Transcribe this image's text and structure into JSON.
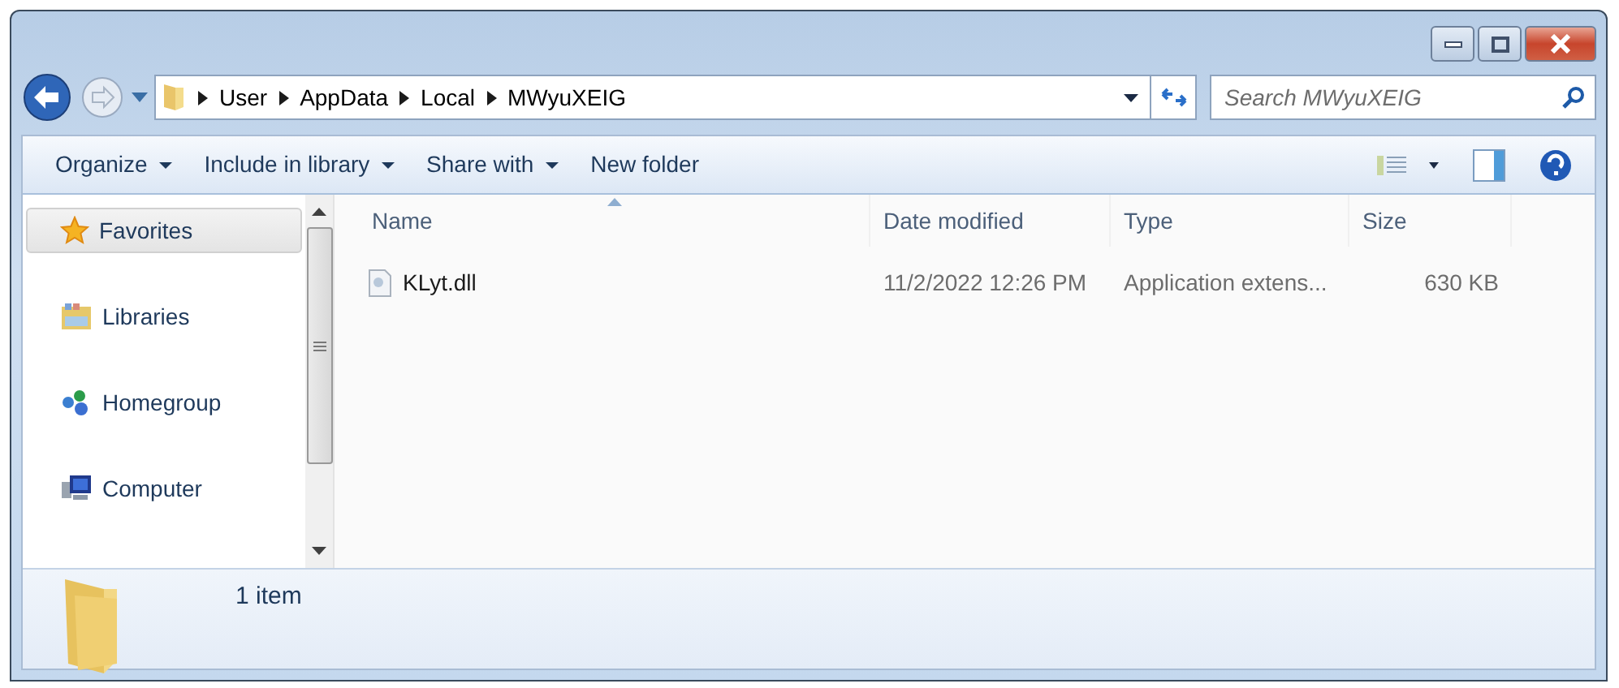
{
  "address": {
    "path": [
      "User",
      "AppData",
      "Local",
      "MWyuXEIG"
    ]
  },
  "search": {
    "placeholder": "Search MWyuXEIG"
  },
  "toolbar": [
    {
      "label": "Organize",
      "has_menu": true
    },
    {
      "label": "Include in library",
      "has_menu": true
    },
    {
      "label": "Share with",
      "has_menu": true
    },
    {
      "label": "New folder",
      "has_menu": false
    }
  ],
  "nav": [
    {
      "label": "Favorites",
      "kind": "favorites",
      "selected": true
    },
    {
      "label": "Libraries",
      "kind": "libraries",
      "selected": false
    },
    {
      "label": "Homegroup",
      "kind": "homegroup",
      "selected": false
    },
    {
      "label": "Computer",
      "kind": "computer",
      "selected": false
    }
  ],
  "columns": [
    {
      "label": "Name",
      "sorted": true
    },
    {
      "label": "Date modified",
      "sorted": false
    },
    {
      "label": "Type",
      "sorted": false
    },
    {
      "label": "Size",
      "sorted": false
    }
  ],
  "files": [
    {
      "name": "KLyt.dll",
      "date_modified": "11/2/2022 12:26 PM",
      "type": "Application extens...",
      "size": "630 KB"
    }
  ],
  "status_bar": {
    "count": "1 item"
  }
}
